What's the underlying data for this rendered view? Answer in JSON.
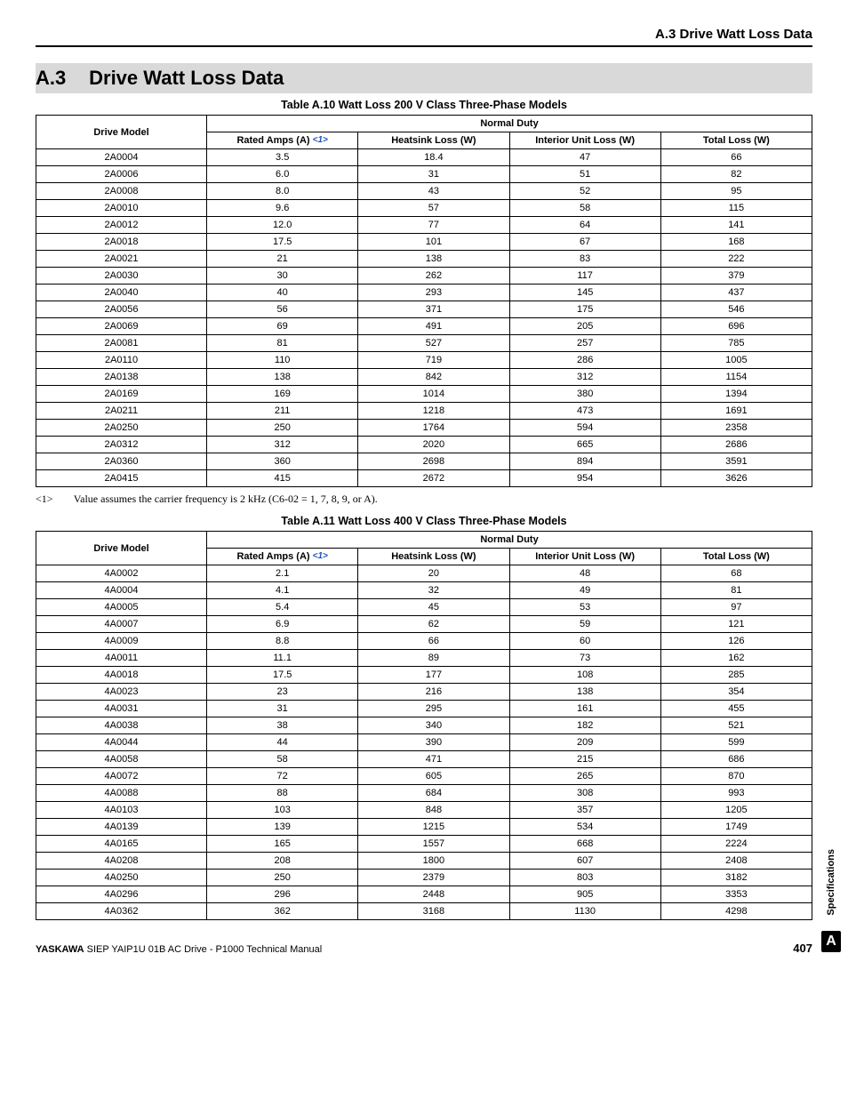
{
  "header": {
    "running_head": "A.3 Drive Watt Loss Data"
  },
  "section": {
    "number": "A.3",
    "title": "Drive Watt Loss Data"
  },
  "table1": {
    "caption": "Table A.10  Watt Loss 200 V Class Three-Phase Models",
    "group_header": "Normal Duty",
    "columns": {
      "model": "Drive Model",
      "rated": "Rated Amps (A)",
      "rated_note_ref": "<1>",
      "heatsink": "Heatsink Loss (W)",
      "interior": "Interior Unit Loss (W)",
      "total": "Total Loss (W)"
    },
    "rows": [
      {
        "model": "2A0004",
        "rated": "3.5",
        "heatsink": "18.4",
        "interior": "47",
        "total": "66"
      },
      {
        "model": "2A0006",
        "rated": "6.0",
        "heatsink": "31",
        "interior": "51",
        "total": "82"
      },
      {
        "model": "2A0008",
        "rated": "8.0",
        "heatsink": "43",
        "interior": "52",
        "total": "95"
      },
      {
        "model": "2A0010",
        "rated": "9.6",
        "heatsink": "57",
        "interior": "58",
        "total": "115"
      },
      {
        "model": "2A0012",
        "rated": "12.0",
        "heatsink": "77",
        "interior": "64",
        "total": "141"
      },
      {
        "model": "2A0018",
        "rated": "17.5",
        "heatsink": "101",
        "interior": "67",
        "total": "168"
      },
      {
        "model": "2A0021",
        "rated": "21",
        "heatsink": "138",
        "interior": "83",
        "total": "222"
      },
      {
        "model": "2A0030",
        "rated": "30",
        "heatsink": "262",
        "interior": "117",
        "total": "379"
      },
      {
        "model": "2A0040",
        "rated": "40",
        "heatsink": "293",
        "interior": "145",
        "total": "437"
      },
      {
        "model": "2A0056",
        "rated": "56",
        "heatsink": "371",
        "interior": "175",
        "total": "546"
      },
      {
        "model": "2A0069",
        "rated": "69",
        "heatsink": "491",
        "interior": "205",
        "total": "696"
      },
      {
        "model": "2A0081",
        "rated": "81",
        "heatsink": "527",
        "interior": "257",
        "total": "785"
      },
      {
        "model": "2A0110",
        "rated": "110",
        "heatsink": "719",
        "interior": "286",
        "total": "1005"
      },
      {
        "model": "2A0138",
        "rated": "138",
        "heatsink": "842",
        "interior": "312",
        "total": "1154"
      },
      {
        "model": "2A0169",
        "rated": "169",
        "heatsink": "1014",
        "interior": "380",
        "total": "1394"
      },
      {
        "model": "2A0211",
        "rated": "211",
        "heatsink": "1218",
        "interior": "473",
        "total": "1691"
      },
      {
        "model": "2A0250",
        "rated": "250",
        "heatsink": "1764",
        "interior": "594",
        "total": "2358"
      },
      {
        "model": "2A0312",
        "rated": "312",
        "heatsink": "2020",
        "interior": "665",
        "total": "2686"
      },
      {
        "model": "2A0360",
        "rated": "360",
        "heatsink": "2698",
        "interior": "894",
        "total": "3591"
      },
      {
        "model": "2A0415",
        "rated": "415",
        "heatsink": "2672",
        "interior": "954",
        "total": "3626"
      }
    ]
  },
  "footnote1": {
    "marker": "<1>",
    "text": "Value assumes the carrier frequency is 2 kHz (C6-02 = 1, 7, 8, 9, or A)."
  },
  "table2": {
    "caption": "Table A.11  Watt Loss 400 V Class Three-Phase Models",
    "group_header": "Normal Duty",
    "columns": {
      "model": "Drive Model",
      "rated": "Rated Amps (A)",
      "rated_note_ref": "<1>",
      "heatsink": "Heatsink Loss (W)",
      "interior": "Interior Unit Loss (W)",
      "total": "Total Loss (W)"
    },
    "rows": [
      {
        "model": "4A0002",
        "rated": "2.1",
        "heatsink": "20",
        "interior": "48",
        "total": "68"
      },
      {
        "model": "4A0004",
        "rated": "4.1",
        "heatsink": "32",
        "interior": "49",
        "total": "81"
      },
      {
        "model": "4A0005",
        "rated": "5.4",
        "heatsink": "45",
        "interior": "53",
        "total": "97"
      },
      {
        "model": "4A0007",
        "rated": "6.9",
        "heatsink": "62",
        "interior": "59",
        "total": "121"
      },
      {
        "model": "4A0009",
        "rated": "8.8",
        "heatsink": "66",
        "interior": "60",
        "total": "126"
      },
      {
        "model": "4A0011",
        "rated": "11.1",
        "heatsink": "89",
        "interior": "73",
        "total": "162"
      },
      {
        "model": "4A0018",
        "rated": "17.5",
        "heatsink": "177",
        "interior": "108",
        "total": "285"
      },
      {
        "model": "4A0023",
        "rated": "23",
        "heatsink": "216",
        "interior": "138",
        "total": "354"
      },
      {
        "model": "4A0031",
        "rated": "31",
        "heatsink": "295",
        "interior": "161",
        "total": "455"
      },
      {
        "model": "4A0038",
        "rated": "38",
        "heatsink": "340",
        "interior": "182",
        "total": "521"
      },
      {
        "model": "4A0044",
        "rated": "44",
        "heatsink": "390",
        "interior": "209",
        "total": "599"
      },
      {
        "model": "4A0058",
        "rated": "58",
        "heatsink": "471",
        "interior": "215",
        "total": "686"
      },
      {
        "model": "4A0072",
        "rated": "72",
        "heatsink": "605",
        "interior": "265",
        "total": "870"
      },
      {
        "model": "4A0088",
        "rated": "88",
        "heatsink": "684",
        "interior": "308",
        "total": "993"
      },
      {
        "model": "4A0103",
        "rated": "103",
        "heatsink": "848",
        "interior": "357",
        "total": "1205"
      },
      {
        "model": "4A0139",
        "rated": "139",
        "heatsink": "1215",
        "interior": "534",
        "total": "1749"
      },
      {
        "model": "4A0165",
        "rated": "165",
        "heatsink": "1557",
        "interior": "668",
        "total": "2224"
      },
      {
        "model": "4A0208",
        "rated": "208",
        "heatsink": "1800",
        "interior": "607",
        "total": "2408"
      },
      {
        "model": "4A0250",
        "rated": "250",
        "heatsink": "2379",
        "interior": "803",
        "total": "3182"
      },
      {
        "model": "4A0296",
        "rated": "296",
        "heatsink": "2448",
        "interior": "905",
        "total": "3353"
      },
      {
        "model": "4A0362",
        "rated": "362",
        "heatsink": "3168",
        "interior": "1130",
        "total": "4298"
      }
    ]
  },
  "sidebar": {
    "label": "Specifications",
    "badge": "A"
  },
  "footer": {
    "brand": "YASKAWA",
    "text": " SIEP YAIP1U 01B AC Drive - P1000 Technical Manual",
    "page": "407"
  }
}
